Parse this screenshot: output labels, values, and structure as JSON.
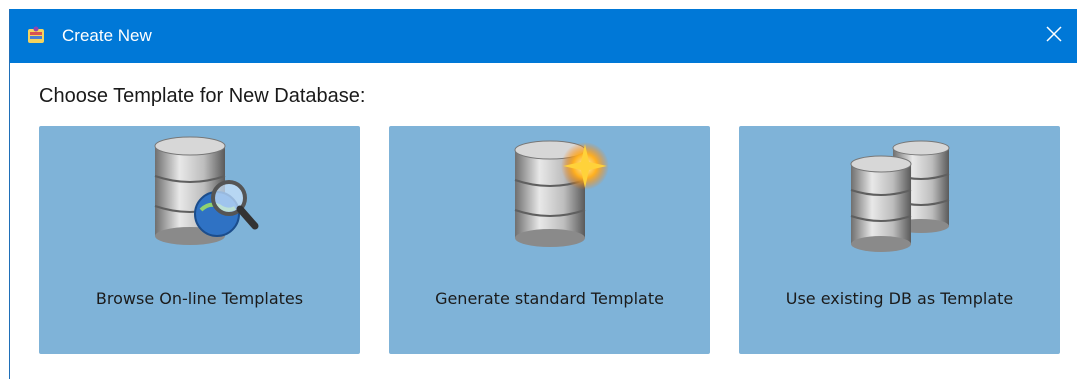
{
  "window": {
    "title": "Create New",
    "close_icon": "close-icon",
    "app_icon": "app-icon"
  },
  "heading": "Choose Template for New Database:",
  "tiles": [
    {
      "label": "Browse On-line Templates",
      "icon": "database-search-icon"
    },
    {
      "label": "Generate standard Template",
      "icon": "database-new-icon"
    },
    {
      "label": "Use existing DB as Template",
      "icon": "database-copy-icon"
    }
  ],
  "colors": {
    "titlebar": "#0078d7",
    "tile": "#7fb3d8"
  }
}
